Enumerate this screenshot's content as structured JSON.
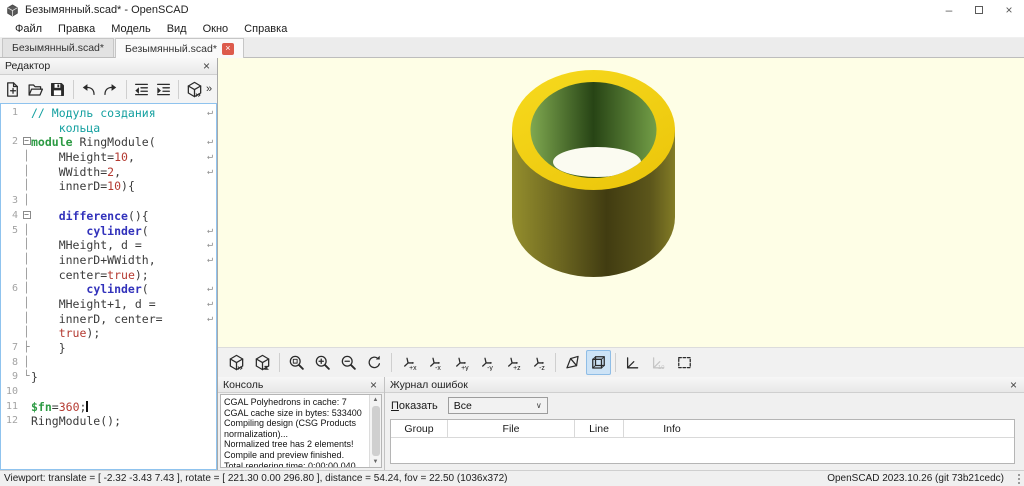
{
  "window": {
    "title": "Безымянный.scad* - OpenSCAD",
    "controls": {
      "minimize": "–",
      "close": "×"
    }
  },
  "menu": {
    "items": [
      "Файл",
      "Правка",
      "Модель",
      "Вид",
      "Окно",
      "Справка"
    ]
  },
  "tabs": [
    {
      "label": "Безымянный.scad*",
      "active": false,
      "closable": false
    },
    {
      "label": "Безымянный.scad*",
      "active": true,
      "closable": true,
      "close_glyph": "×"
    }
  ],
  "editor": {
    "title": "Редактор",
    "close_glyph": "×",
    "toolbar": [
      {
        "icon": "new-file-icon",
        "name": "new-file-button"
      },
      {
        "icon": "open-file-icon",
        "name": "open-file-button"
      },
      {
        "icon": "save-icon",
        "name": "save-button"
      },
      {
        "sep": true
      },
      {
        "icon": "undo-icon",
        "name": "undo-button"
      },
      {
        "icon": "redo-icon",
        "name": "redo-button"
      },
      {
        "sep": true
      },
      {
        "icon": "unindent-icon",
        "name": "unindent-button"
      },
      {
        "icon": "indent-icon",
        "name": "indent-button"
      },
      {
        "sep": true
      },
      {
        "icon": "preview-icon",
        "name": "preview-button"
      }
    ],
    "overflow_glyph": "»",
    "rows": [
      {
        "n": "1",
        "f": "",
        "w": true,
        "s": [
          [
            "// Модуль создания",
            "c"
          ]
        ]
      },
      {
        "n": "",
        "f": "",
        "w": false,
        "s": [
          [
            "    кольца",
            "c"
          ]
        ]
      },
      {
        "n": "2",
        "f": "b",
        "w": true,
        "s": [
          [
            "module",
            "m"
          ],
          [
            " RingModule(",
            "d"
          ]
        ]
      },
      {
        "n": "",
        "f": "v",
        "w": true,
        "s": [
          [
            "    MHeight=",
            "d"
          ],
          [
            "10",
            "n"
          ],
          [
            ",",
            "d"
          ]
        ]
      },
      {
        "n": "",
        "f": "v",
        "w": true,
        "s": [
          [
            "    WWidth=",
            "d"
          ],
          [
            "2",
            "n"
          ],
          [
            ",",
            "d"
          ]
        ]
      },
      {
        "n": "",
        "f": "v",
        "w": false,
        "s": [
          [
            "    innerD=",
            "d"
          ],
          [
            "10",
            "n"
          ],
          [
            "){",
            "d"
          ]
        ]
      },
      {
        "n": "3",
        "f": "v",
        "w": false,
        "s": []
      },
      {
        "n": "4",
        "f": "b",
        "w": false,
        "s": [
          [
            "    ",
            "d"
          ],
          [
            "difference",
            "k"
          ],
          [
            "(){",
            "d"
          ]
        ]
      },
      {
        "n": "5",
        "f": "v",
        "w": true,
        "s": [
          [
            "        ",
            "d"
          ],
          [
            "cylinder",
            "k"
          ],
          [
            "(",
            "d"
          ]
        ]
      },
      {
        "n": "",
        "f": "v",
        "w": true,
        "s": [
          [
            "    MHeight, d =",
            "d"
          ]
        ]
      },
      {
        "n": "",
        "f": "v",
        "w": true,
        "s": [
          [
            "    innerD+WWidth,",
            "d"
          ]
        ]
      },
      {
        "n": "",
        "f": "v",
        "w": false,
        "s": [
          [
            "    center=",
            "d"
          ],
          [
            "true",
            "n"
          ],
          [
            ");",
            "d"
          ]
        ]
      },
      {
        "n": "6",
        "f": "v",
        "w": true,
        "s": [
          [
            "        ",
            "d"
          ],
          [
            "cylinder",
            "k"
          ],
          [
            "(",
            "d"
          ]
        ]
      },
      {
        "n": "",
        "f": "v",
        "w": true,
        "s": [
          [
            "    MHeight+1, d =",
            "d"
          ]
        ]
      },
      {
        "n": "",
        "f": "v",
        "w": true,
        "s": [
          [
            "    innerD, center=",
            "d"
          ]
        ]
      },
      {
        "n": "",
        "f": "v",
        "w": false,
        "s": [
          [
            "    ",
            "d"
          ],
          [
            "true",
            "n"
          ],
          [
            ");",
            "d"
          ]
        ]
      },
      {
        "n": "7",
        "f": "t",
        "w": false,
        "s": [
          [
            "    }",
            "d"
          ]
        ]
      },
      {
        "n": "8",
        "f": "v",
        "w": false,
        "s": []
      },
      {
        "n": "9",
        "f": "e",
        "w": false,
        "s": [
          [
            "}",
            "d"
          ]
        ]
      },
      {
        "n": "10",
        "f": "",
        "w": false,
        "s": []
      },
      {
        "n": "11",
        "f": "",
        "w": false,
        "cur": true,
        "s": [
          [
            "$fn",
            "m"
          ],
          [
            "=",
            "d"
          ],
          [
            "360",
            "n"
          ],
          [
            ";",
            "d"
          ]
        ]
      },
      {
        "n": "12",
        "f": "",
        "w": false,
        "s": [
          [
            "RingModule();",
            "d"
          ]
        ]
      }
    ],
    "wrap_glyph": "↵"
  },
  "viewport": {
    "background": "#fefee6",
    "model": {
      "kind": "ring-cylinder",
      "rim_color": "#f5d614",
      "rim_color_dark": "#ecc70c",
      "outer_wall_colors": [
        "#948e2d",
        "#6b6520",
        "#413c11",
        "#5c561b",
        "#837c26"
      ],
      "inner_wall_colors": [
        "#7fa850",
        "#274415",
        "#739e47"
      ],
      "hole_color": "#fbfbf1"
    },
    "toolbar": [
      {
        "icon": "preview-icon",
        "name": "vp-preview-button"
      },
      {
        "icon": "render-icon",
        "name": "vp-render-button"
      },
      {
        "sep": true
      },
      {
        "icon": "zoom-all-icon",
        "name": "zoom-all-button"
      },
      {
        "icon": "zoom-in-icon",
        "name": "zoom-in-button"
      },
      {
        "icon": "zoom-out-icon",
        "name": "zoom-out-button"
      },
      {
        "icon": "reset-view-icon",
        "name": "reset-view-button"
      },
      {
        "sep": true
      },
      {
        "icon": "axis-view-icon",
        "label": "+x",
        "name": "view-pos-x-button"
      },
      {
        "icon": "axis-view-icon",
        "label": "-x",
        "name": "view-neg-x-button"
      },
      {
        "icon": "axis-view-icon",
        "label": "+y",
        "name": "view-pos-y-button"
      },
      {
        "icon": "axis-view-icon",
        "label": "-y",
        "name": "view-neg-y-button"
      },
      {
        "icon": "axis-view-icon",
        "label": "+z",
        "name": "view-pos-z-button"
      },
      {
        "icon": "axis-view-icon",
        "label": "-z",
        "name": "view-neg-z-button"
      },
      {
        "sep": true
      },
      {
        "icon": "perspective-icon",
        "name": "perspective-button"
      },
      {
        "icon": "orthographic-icon",
        "name": "orthographic-button",
        "selected": true
      },
      {
        "sep": true
      },
      {
        "icon": "show-axes-icon",
        "name": "show-axes-button"
      },
      {
        "icon": "show-scale-markers-icon",
        "name": "show-scale-markers-button",
        "disabled": true
      },
      {
        "icon": "view-all-icon",
        "name": "view-all-button"
      }
    ]
  },
  "console": {
    "title": "Консоль",
    "close_glyph": "×",
    "lines": [
      "CGAL Polyhedrons in cache: 7",
      "CGAL cache size in bytes: 533400",
      "Compiling design (CSG Products normalization)...",
      "Normalized tree has 2 elements!",
      "Compile and preview finished.",
      "Total rendering time: 0:00:00.040"
    ]
  },
  "error_log": {
    "title": "Журнал ошибок",
    "close_glyph": "×",
    "show_label_accel": "П",
    "show_label_rest": "оказать",
    "filter_value": "Все",
    "columns": [
      "Group",
      "File",
      "Line",
      "Info"
    ]
  },
  "status_bar": {
    "left": "Viewport: translate = [ -2.32 -3.43 7.43 ], rotate = [ 221.30 0.00 296.80 ], distance = 54.24, fov = 22.50 (1036x372)",
    "right": "OpenSCAD 2023.10.26 (git 73b21cedc)"
  }
}
